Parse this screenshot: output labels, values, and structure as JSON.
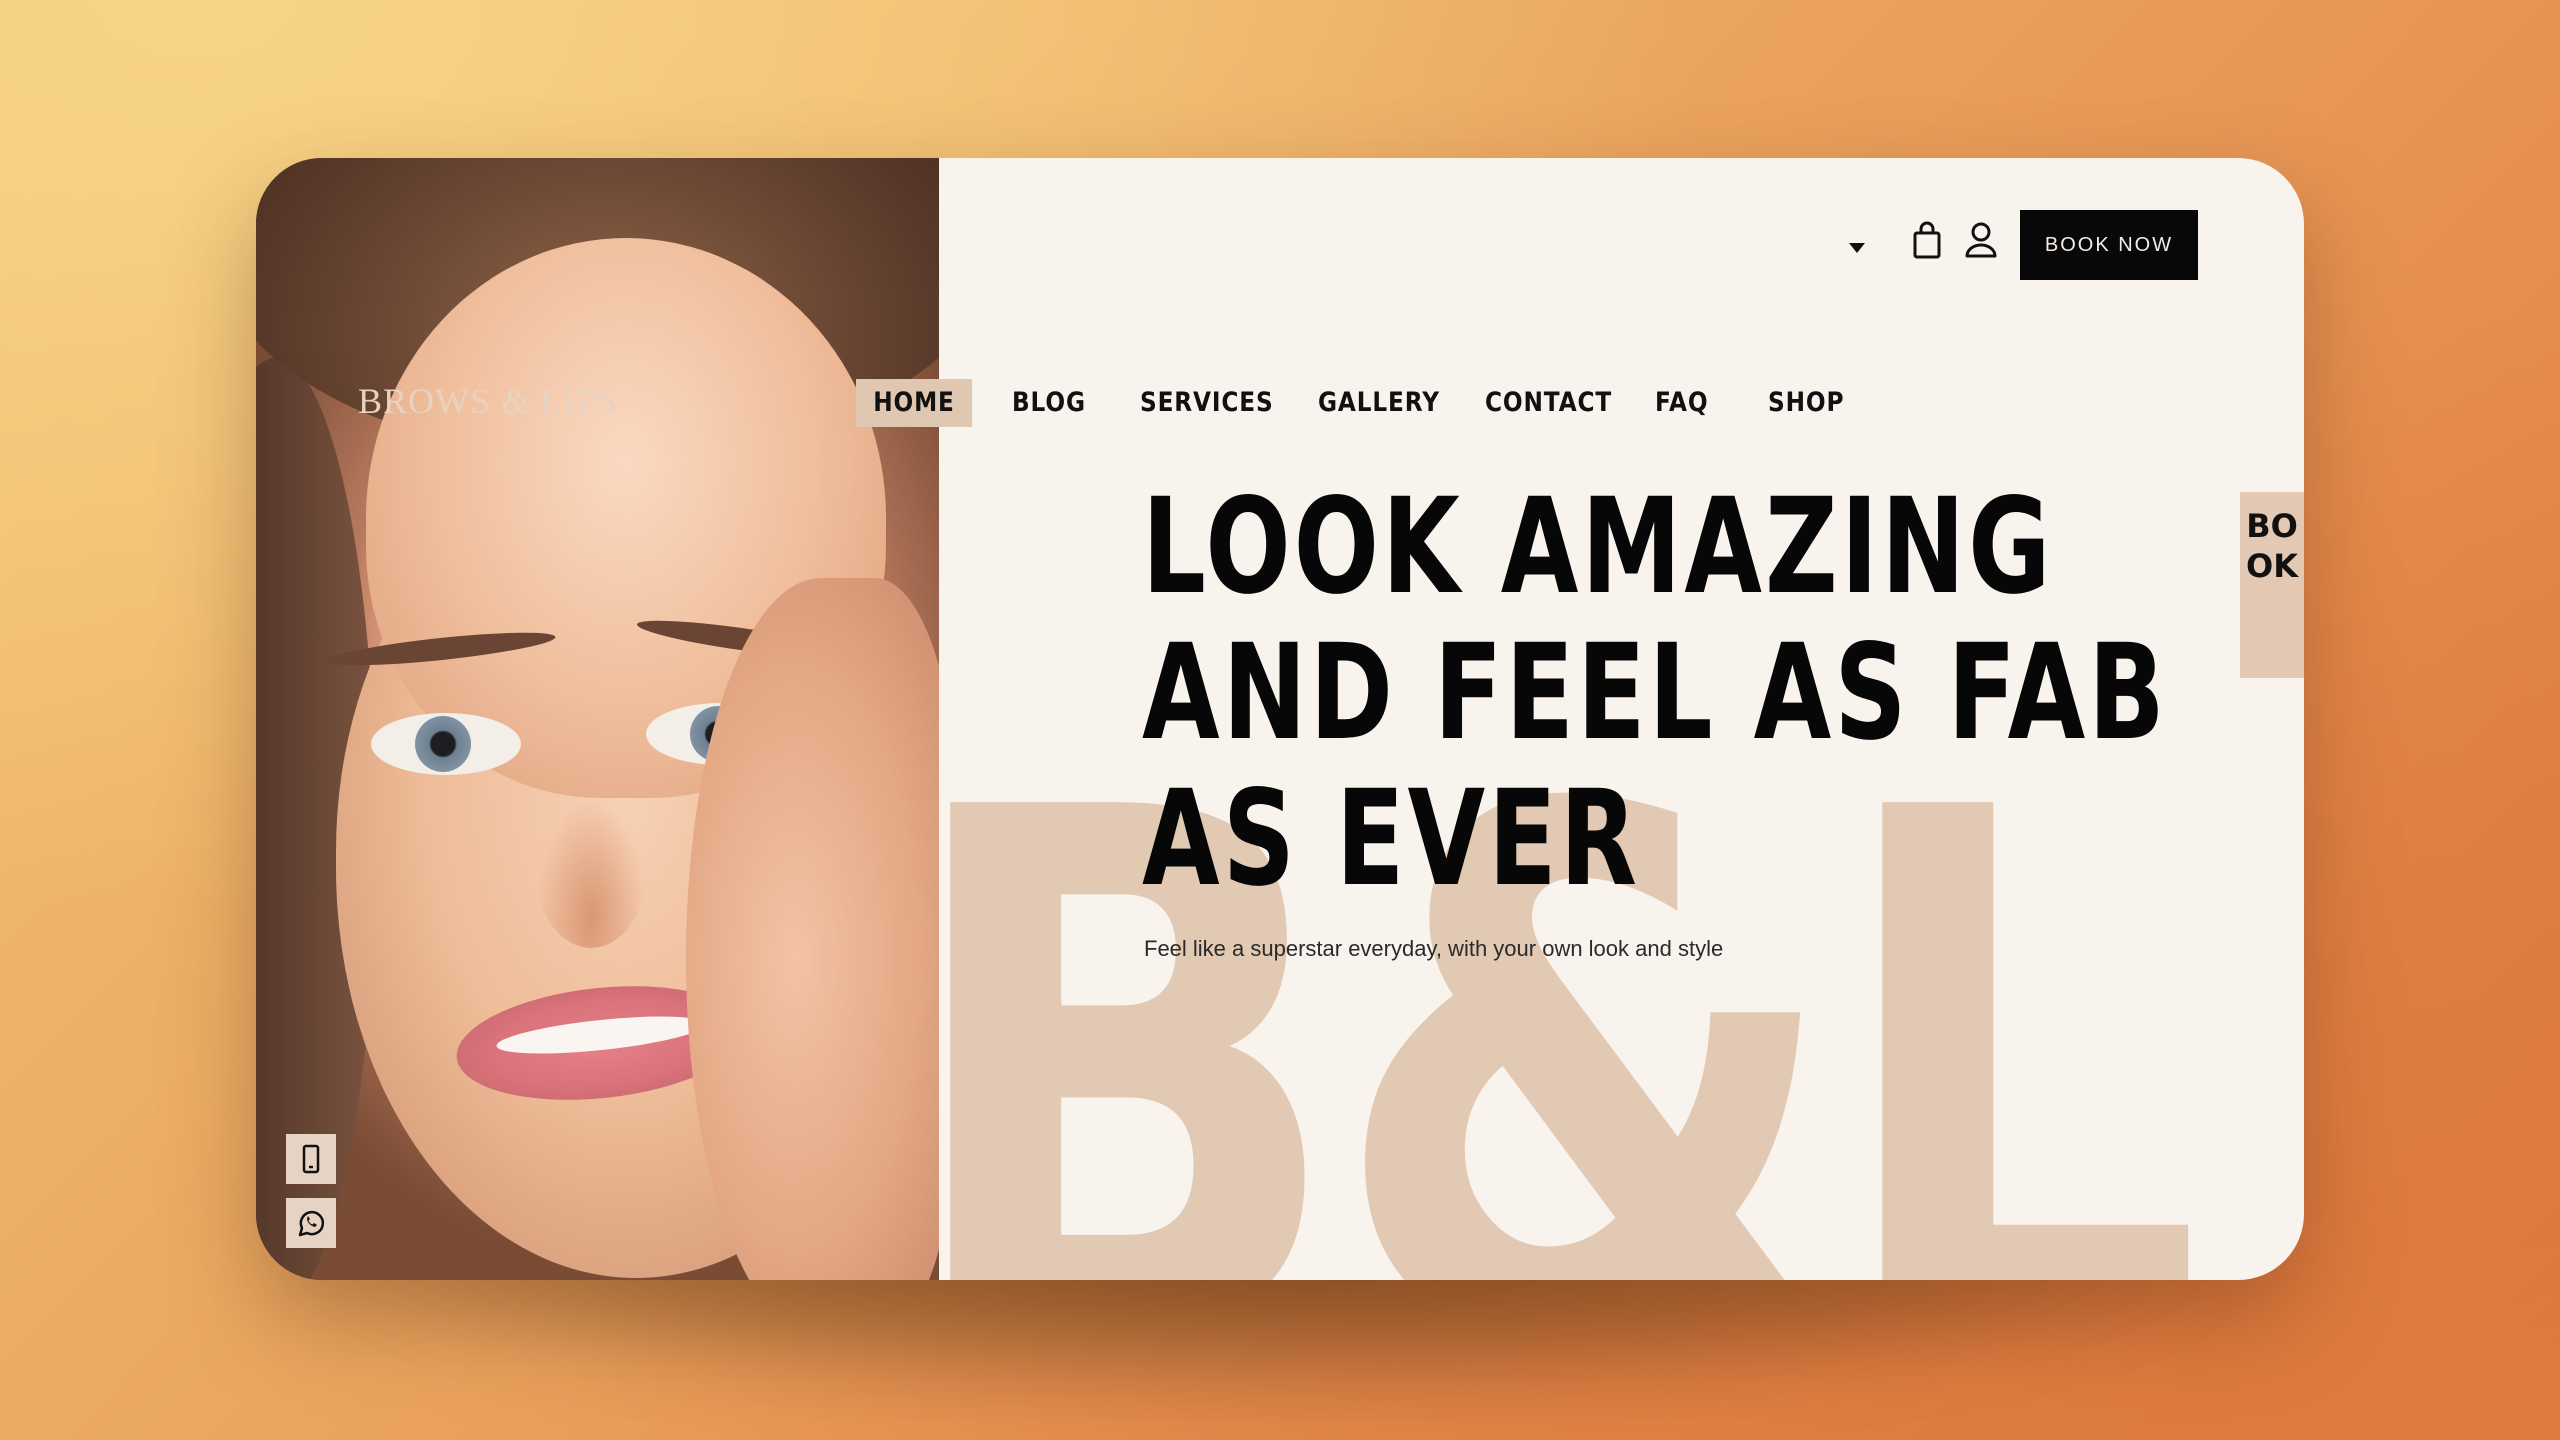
{
  "brand": {
    "logo_text_a": "BROWS ",
    "logo_amp": "&",
    "logo_text_b": " LIPS",
    "watermark": "B&L"
  },
  "nav": {
    "items": [
      {
        "label": "HOME",
        "active": true
      },
      {
        "label": "BLOG",
        "active": false
      },
      {
        "label": "SERVICES",
        "active": false
      },
      {
        "label": "GALLERY",
        "active": false
      },
      {
        "label": "CONTACT",
        "active": false
      },
      {
        "label": "FAQ",
        "active": false
      },
      {
        "label": "SHOP",
        "active": false
      }
    ],
    "cart_icon": "shopping-bag-icon",
    "account_icon": "user-icon",
    "book_now_label": "BOOK NOW"
  },
  "hero": {
    "title_lines": [
      "LOOK AMAZING",
      "AND FEEL AS FAB",
      "AS EVER"
    ],
    "subtitle": "Feel like a superstar everyday, with your own look and style"
  },
  "side_tab": {
    "label": "BOOK"
  },
  "contact": {
    "phone_icon": "mobile-phone-icon",
    "whatsapp_icon": "whatsapp-icon"
  },
  "colors": {
    "accent": "#e0c7b1",
    "background": "#f9f3ee",
    "text": "#070707",
    "button": "#080808"
  }
}
